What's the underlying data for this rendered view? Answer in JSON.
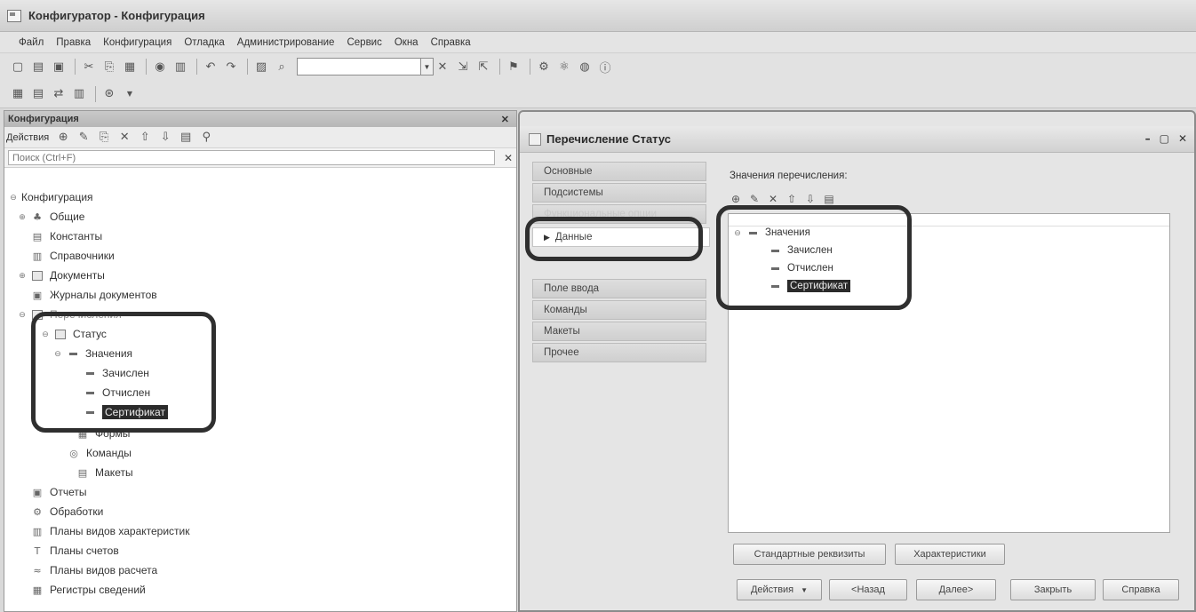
{
  "window": {
    "title": "Конфигуратор - Конфигурация"
  },
  "menu": [
    "Файл",
    "Правка",
    "Конфигурация",
    "Отладка",
    "Администрирование",
    "Сервис",
    "Окна",
    "Справка"
  ],
  "left_panel": {
    "title": "Конфигурация",
    "actions_label": "Действия",
    "search_placeholder": "Поиск (Ctrl+F)",
    "tree": {
      "root": "Конфигурация",
      "common": "Общие",
      "constants": "Константы",
      "catalogs": "Справочники",
      "documents": "Документы",
      "doc_journals": "Журналы документов",
      "enums": "Перечисления",
      "status": "Статус",
      "values": "Значения",
      "v1": "Зачислен",
      "v2": "Отчислен",
      "v3": "Сертификат",
      "forms": "Формы",
      "commands": "Команды",
      "templates": "Макеты",
      "reports": "Отчеты",
      "processors": "Обработки",
      "pvh": "Планы видов характеристик",
      "accounts": "Планы счетов",
      "calc_types": "Планы видов расчета",
      "info_registers": "Регистры сведений"
    }
  },
  "dialog": {
    "title": "Перечисление Статус",
    "tabs": {
      "main": "Основные",
      "subsystems": "Подсистемы",
      "functional_options": "Функциональные опции",
      "data": "Данные",
      "input_field": "Поле ввода",
      "commands": "Команды",
      "templates": "Макеты",
      "other": "Прочее"
    },
    "values_label": "Значения перечисления:",
    "values_root": "Значения",
    "values": [
      "Зачислен",
      "Отчислен",
      "Сертификат"
    ],
    "buttons": {
      "std_attrs": "Стандартные реквизиты",
      "characteristics": "Характеристики",
      "actions": "Действия",
      "back": "<Назад",
      "next": "Далее>",
      "close": "Закрыть",
      "help": "Справка"
    }
  }
}
